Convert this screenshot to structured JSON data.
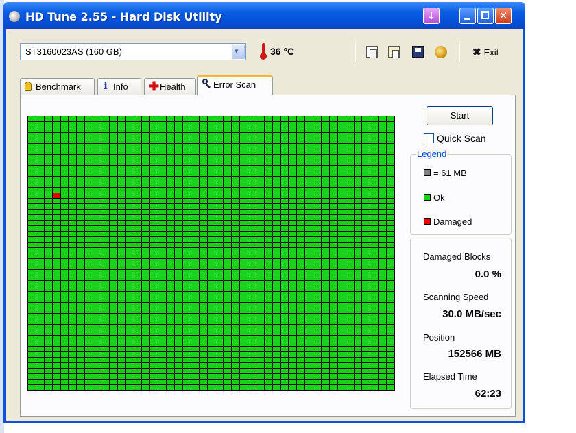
{
  "window": {
    "title": "HD Tune 2.55 - Hard Disk Utility"
  },
  "toolbar": {
    "drive": "ST3160023AS (160 GB)",
    "temperature": "36 °C",
    "exit_label": "Exit"
  },
  "tabs": [
    {
      "label": "Benchmark",
      "icon": "benchmark-icon",
      "active": false
    },
    {
      "label": "Info",
      "icon": "info-icon",
      "active": false
    },
    {
      "label": "Health",
      "icon": "health-icon",
      "active": false
    },
    {
      "label": "Error Scan",
      "icon": "magnifier-icon",
      "active": true
    }
  ],
  "error_scan": {
    "start_label": "Start",
    "quick_scan_label": "Quick Scan",
    "quick_scan_checked": false,
    "legend": {
      "title": "Legend",
      "block_size": "= 61 MB",
      "ok": "Ok",
      "damaged": "Damaged"
    },
    "stats": {
      "damaged_blocks_label": "Damaged Blocks",
      "damaged_blocks_value": "0.0 %",
      "scanning_speed_label": "Scanning Speed",
      "scanning_speed_value": "30.0 MB/sec",
      "position_label": "Position",
      "position_value": "152566 MB",
      "elapsed_time_label": "Elapsed Time",
      "elapsed_time_value": "62:23"
    },
    "grid": {
      "columns": 45,
      "rows": 50,
      "damaged_cells": [
        [
          14,
          3
        ]
      ]
    }
  },
  "colors": {
    "ok": "#19d319",
    "damaged": "#e80000",
    "unscanned": "#808080",
    "titlebar": "#0b5fe3"
  }
}
